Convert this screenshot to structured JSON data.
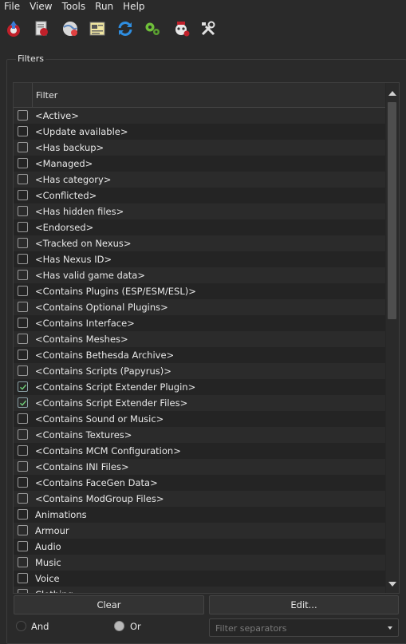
{
  "menu": [
    "File",
    "View",
    "Tools",
    "Run",
    "Help"
  ],
  "toolbar": {
    "icons": [
      "install-mod-icon",
      "profiles-icon",
      "nexus-globe-icon",
      "ini-editor-icon",
      "refresh-icon",
      "settings-gears-icon",
      "problems-icon",
      "tools-icon"
    ]
  },
  "filters": {
    "group_title": "Filters",
    "column_header": "Filter",
    "rows": [
      {
        "label": "<Active>",
        "checked": false
      },
      {
        "label": "<Update available>",
        "checked": false
      },
      {
        "label": "<Has backup>",
        "checked": false
      },
      {
        "label": "<Managed>",
        "checked": false
      },
      {
        "label": "<Has category>",
        "checked": false
      },
      {
        "label": "<Conflicted>",
        "checked": false
      },
      {
        "label": "<Has hidden files>",
        "checked": false
      },
      {
        "label": "<Endorsed>",
        "checked": false
      },
      {
        "label": "<Tracked on Nexus>",
        "checked": false
      },
      {
        "label": "<Has Nexus ID>",
        "checked": false
      },
      {
        "label": "<Has valid game data>",
        "checked": false
      },
      {
        "label": "<Contains Plugins (ESP/ESM/ESL)>",
        "checked": false
      },
      {
        "label": "<Contains Optional Plugins>",
        "checked": false
      },
      {
        "label": "<Contains Interface>",
        "checked": false
      },
      {
        "label": "<Contains Meshes>",
        "checked": false
      },
      {
        "label": "<Contains Bethesda Archive>",
        "checked": false
      },
      {
        "label": "<Contains Scripts (Papyrus)>",
        "checked": false
      },
      {
        "label": "<Contains Script Extender Plugin>",
        "checked": true
      },
      {
        "label": "<Contains Script Extender Files>",
        "checked": true
      },
      {
        "label": "<Contains Sound or Music>",
        "checked": false
      },
      {
        "label": "<Contains Textures>",
        "checked": false
      },
      {
        "label": "<Contains MCM Configuration>",
        "checked": false
      },
      {
        "label": "<Contains INI Files>",
        "checked": false
      },
      {
        "label": "<Contains FaceGen Data>",
        "checked": false
      },
      {
        "label": "<Contains ModGroup Files>",
        "checked": false
      },
      {
        "label": "Animations",
        "checked": false
      },
      {
        "label": "Armour",
        "checked": false
      },
      {
        "label": "Audio",
        "checked": false
      },
      {
        "label": "Music",
        "checked": false
      },
      {
        "label": "Voice",
        "checked": false
      },
      {
        "label": "Clothing",
        "checked": false
      }
    ]
  },
  "buttons": {
    "clear": "Clear",
    "edit": "Edit..."
  },
  "logic": {
    "and_label": "And",
    "or_label": "Or",
    "selected": "Or"
  },
  "separator_filter": {
    "placeholder": "Filter separators"
  }
}
